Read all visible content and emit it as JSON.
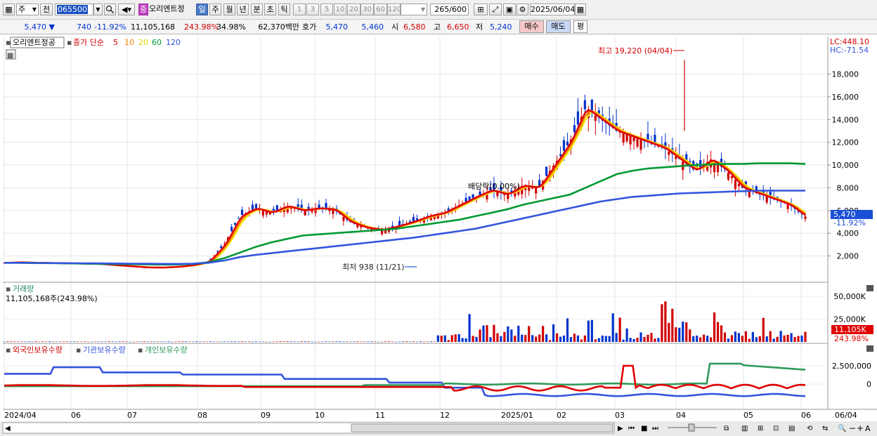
{
  "toolbar": {
    "period": "주",
    "prev": "전",
    "code": "065500",
    "badge": "중",
    "name": "오리엔트정",
    "tabs": [
      "일",
      "주",
      "월",
      "년",
      "분",
      "초",
      "틱"
    ],
    "active_tab": 0,
    "nums": [
      "1",
      "3",
      "5",
      "10",
      "20",
      "30",
      "60",
      "120"
    ],
    "count": "265",
    "count_max": "/600",
    "date": "2025/06/04"
  },
  "quote": {
    "price": "5,470",
    "change": "740",
    "change_pct": "-11.92%",
    "volume": "11,105,168",
    "vol_ratio": "243.98%",
    "turnover": "34.98%",
    "amount": "62,370백만",
    "hoga_label": "호가",
    "ask": "5,470",
    "bid": "5,460",
    "open_label": "시",
    "open": "6,580",
    "high_label": "고",
    "high": "6,650",
    "low_label": "저",
    "low": "5,240",
    "buy": "매수",
    "sell": "매도",
    "avg": "평"
  },
  "price_panel": {
    "name": "오리엔트정공",
    "ma_label": "종가 단순",
    "ma_periods": [
      "5",
      "10",
      "20",
      "60",
      "120"
    ],
    "lc": "LC:448.10",
    "hc": "HC:-71.54",
    "current": "5,470",
    "current_pct": "-11.92%",
    "max_label": "최고 19,220 (04/04)",
    "min_label": "최저 938 (11/21)",
    "dividend_label": "배당락(0.00%)"
  },
  "volume_panel": {
    "title": "거래량",
    "value": "11,105,168주(243.98%)",
    "current": "11,105K",
    "current_pct": "243.98%"
  },
  "holdings_panel": {
    "legend": [
      "외국인보유수량",
      "기관보유수량",
      "개인보유수량"
    ],
    "yticks": [
      "2,500,000",
      "0"
    ]
  },
  "x_axis": {
    "labels": [
      "2024/04",
      "06",
      "07",
      "08",
      "09",
      "10",
      "11",
      "12",
      "2025/01",
      "02",
      "03",
      "04",
      "05",
      "06"
    ],
    "right_label": "06/04"
  },
  "colors": {
    "up": "#d00000",
    "down": "#0033cc",
    "ma5": "#e00000",
    "ma10": "#f08000",
    "ma20": "#f5e600",
    "ma60": "#009933",
    "ma120": "#3355dd",
    "foreign": "#e00000",
    "institution": "#3355dd",
    "individual": "#2f9a5a"
  },
  "chart_data": {
    "type": "candlestick",
    "x_labels": [
      "2024/04",
      "06",
      "07",
      "08",
      "09",
      "10",
      "11",
      "12",
      "2025/01",
      "02",
      "03",
      "04",
      "05",
      "06"
    ],
    "price_yticks": [
      "2,000",
      "4,000",
      "6,000",
      "8,000",
      "10,000",
      "12,000",
      "14,000",
      "16,000",
      "18,000"
    ],
    "price_ylim": [
      0,
      20500
    ],
    "price_close_est": [
      1400,
      1450,
      1400,
      1380,
      1350,
      1330,
      1300,
      1200,
      1100,
      1000,
      980,
      1050,
      1200,
      1500,
      3000,
      5500,
      6200,
      5800,
      6400,
      6000,
      6200,
      6100,
      5000,
      4500,
      4300,
      4600,
      5000,
      5500,
      5800,
      6500,
      7200,
      7800,
      7400,
      8200,
      8000,
      10000,
      12000,
      15000,
      14000,
      13000,
      12500,
      12000,
      11500,
      10500,
      9500,
      10500,
      9500,
      8000,
      7500,
      7000,
      6500,
      5470
    ],
    "ma60_est": [
      1400,
      1400,
      1380,
      1370,
      1350,
      1330,
      1310,
      1290,
      1280,
      1260,
      1250,
      1250,
      1300,
      1450,
      1800,
      2300,
      2800,
      3200,
      3500,
      3800,
      3900,
      4000,
      4100,
      4200,
      4300,
      4400,
      4600,
      4800,
      5000,
      5200,
      5500,
      5800,
      6100,
      6500,
      6800,
      7100,
      7400,
      8000,
      8600,
      9200,
      9500,
      9700,
      9800,
      9900,
      10000,
      10050,
      10100,
      10100,
      10150,
      10150,
      10150,
      10100
    ],
    "ma120_est": [
      1400,
      1400,
      1390,
      1380,
      1370,
      1360,
      1350,
      1340,
      1330,
      1320,
      1310,
      1300,
      1320,
      1400,
      1600,
      1900,
      2100,
      2250,
      2400,
      2550,
      2700,
      2850,
      3000,
      3150,
      3300,
      3450,
      3600,
      3800,
      4000,
      4200,
      4400,
      4700,
      5000,
      5300,
      5600,
      5900,
      6200,
      6500,
      6800,
      7000,
      7200,
      7300,
      7400,
      7500,
      7550,
      7600,
      7650,
      7700,
      7750,
      7750,
      7750,
      7750
    ],
    "volume_yticks": [
      "25,000K",
      "50,000K"
    ],
    "volume_ylim": [
      0,
      60000
    ],
    "holdings_yticks": [
      "0",
      "2,500,000"
    ]
  }
}
